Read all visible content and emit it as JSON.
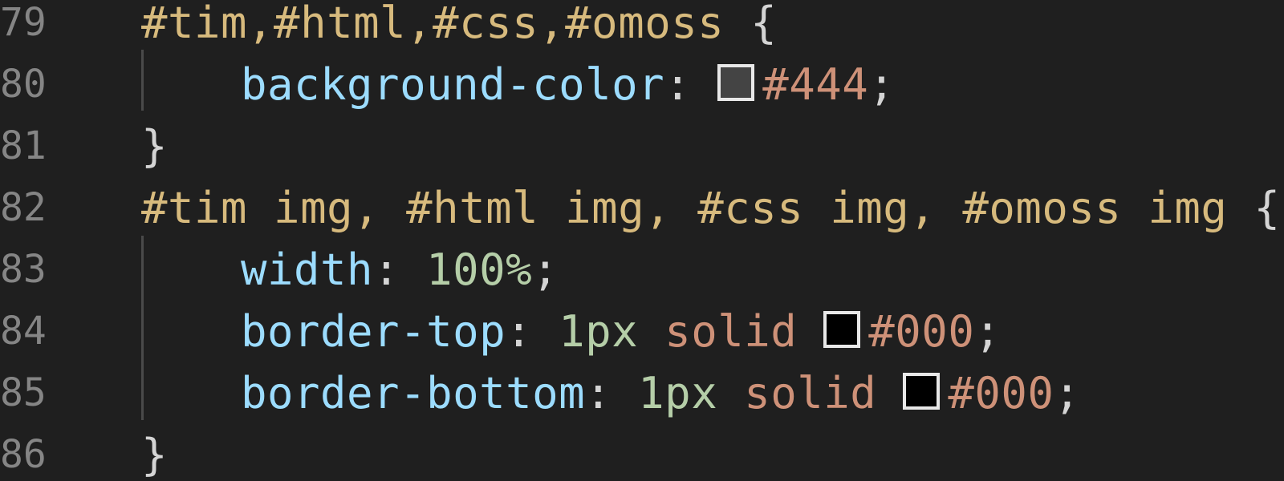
{
  "editor": {
    "colors": {
      "background": "#1f1f1f",
      "line_number": "#858585",
      "selector": "#d7ba7d",
      "punctuation": "#d4d4d4",
      "property": "#9cdcfe",
      "value": "#ce9178",
      "number": "#b5cea8"
    },
    "lines": [
      {
        "number": "79",
        "selector": "#tim,#html,#css,#omoss",
        "open": "{"
      },
      {
        "number": "80",
        "property": "background-color",
        "colon": ":",
        "swatch_color": "#444444",
        "value": "#444",
        "semicolon": ";"
      },
      {
        "number": "81",
        "close": "}"
      },
      {
        "number": "82",
        "selector": "#tim img, #html img, #css img, #omoss img",
        "open": "{"
      },
      {
        "number": "83",
        "property": "width",
        "colon": ":",
        "value_num": "100%",
        "semicolon": ";"
      },
      {
        "number": "84",
        "property": "border-top",
        "colon": ":",
        "value_num": "1px",
        "value_kw": "solid",
        "swatch_color": "#000000",
        "value": "#000",
        "semicolon": ";"
      },
      {
        "number": "85",
        "property": "border-bottom",
        "colon": ":",
        "value_num": "1px",
        "value_kw": "solid",
        "swatch_color": "#000000",
        "value": "#000",
        "semicolon": ";"
      },
      {
        "number": "86",
        "close": "}"
      }
    ]
  }
}
